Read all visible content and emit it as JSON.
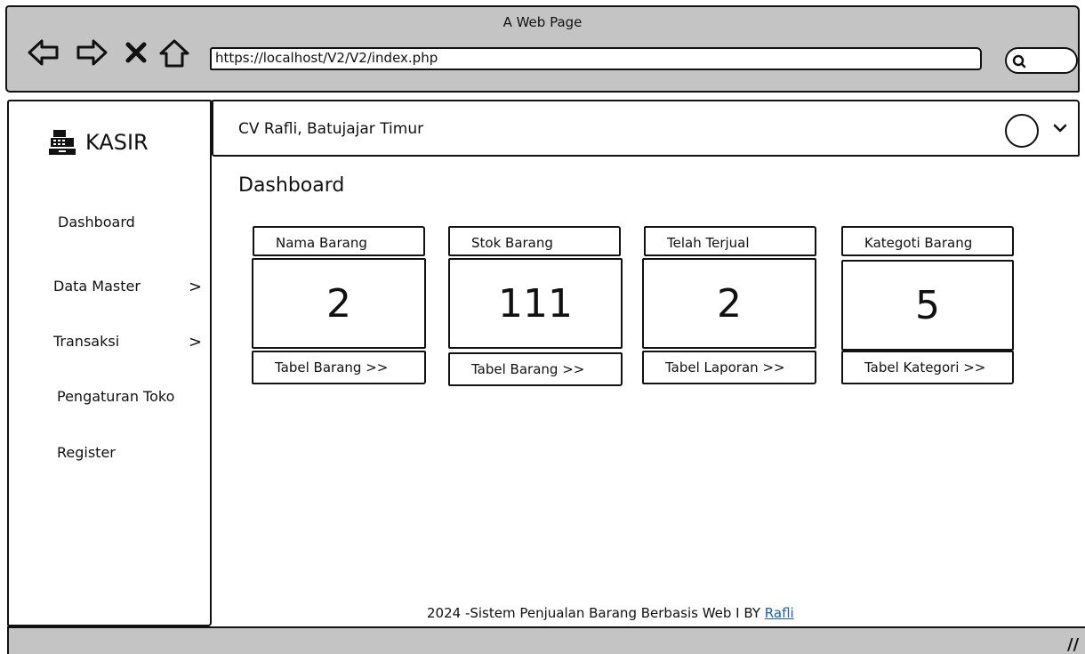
{
  "window": {
    "title": "A Web Page",
    "url": "https://localhost/V2/V2/index.php"
  },
  "sidebar": {
    "brand": "KASIR",
    "items": [
      {
        "label": "Dashboard"
      },
      {
        "label": "Data Master",
        "chevron": ">"
      },
      {
        "label": "Transaksi",
        "chevron": ">"
      },
      {
        "label": "Pengaturan Toko"
      },
      {
        "label": "Register"
      }
    ]
  },
  "topbar": {
    "store_name": "CV Rafli, Batujajar Timur"
  },
  "main": {
    "page_title": "Dashboard",
    "cards": [
      {
        "title": "Nama Barang",
        "value": "2",
        "link": "Tabel Barang >>"
      },
      {
        "title": "Stok Barang",
        "value": "111",
        "link": "Tabel Barang >>"
      },
      {
        "title": "Telah Terjual",
        "value": "2",
        "link": "Tabel Laporan >>"
      },
      {
        "title": "Kategoti Barang",
        "value": "5",
        "link": "Tabel Kategori >>"
      }
    ]
  },
  "footer": {
    "text": "2024 -Sistem Penjualan Barang Berbasis Web I BY",
    "link": "Rafli"
  },
  "icons": {
    "back": "back-arrow-icon",
    "forward": "forward-arrow-icon",
    "stop": "close-icon",
    "home": "home-icon",
    "search": "search-icon",
    "brand": "cash-register-icon",
    "avatar": "user-avatar-icon",
    "chevron": "chevron-down-icon"
  },
  "colors": {
    "chrome": "#c4c4c4",
    "link": "#1a5fb4"
  }
}
